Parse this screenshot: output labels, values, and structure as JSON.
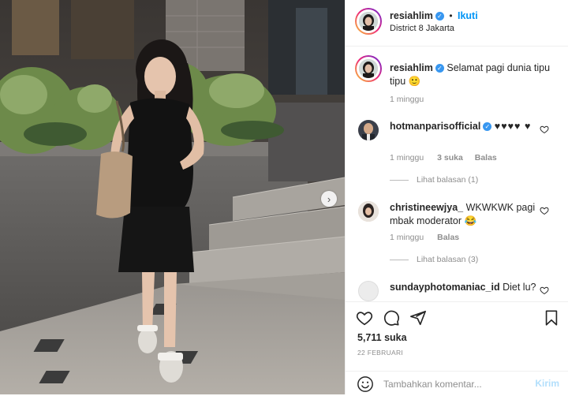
{
  "post": {
    "author": "resiahlim",
    "follow_label": "Ikuti",
    "location": "District 8 Jakarta",
    "caption": "Selamat pagi dunia tipu tipu 🙂",
    "caption_time": "1 minggu"
  },
  "comments": [
    {
      "user": "hotmanparisofficial",
      "text": "♥♥♥♥ ♥",
      "time": "1 minggu",
      "likes": "3 suka",
      "reply": "Balas",
      "view_replies": "Lihat balasan (1)"
    },
    {
      "user": "christineewjya_",
      "text": "WKWKWK pagi mbak moderator 😂",
      "time": "1 minggu",
      "reply": "Balas",
      "view_replies": "Lihat balasan (3)"
    },
    {
      "user": "sundayphotomaniac_id",
      "text": "Diet lu?"
    }
  ],
  "actions": {
    "likes_count": "5,711 suka",
    "date": "22 FEBRUARI"
  },
  "composer": {
    "placeholder": "Tambahkan komentar...",
    "send_label": "Kirim"
  },
  "icons": [
    "heart-icon",
    "comment-icon",
    "share-icon",
    "bookmark-icon",
    "emoji-icon",
    "chevron-right-icon",
    "verified-icon"
  ],
  "colors": {
    "accent": "#0095f6",
    "verified": "#3897f0",
    "muted": "#8e8e8e",
    "send_disabled": "#b2dffc"
  }
}
